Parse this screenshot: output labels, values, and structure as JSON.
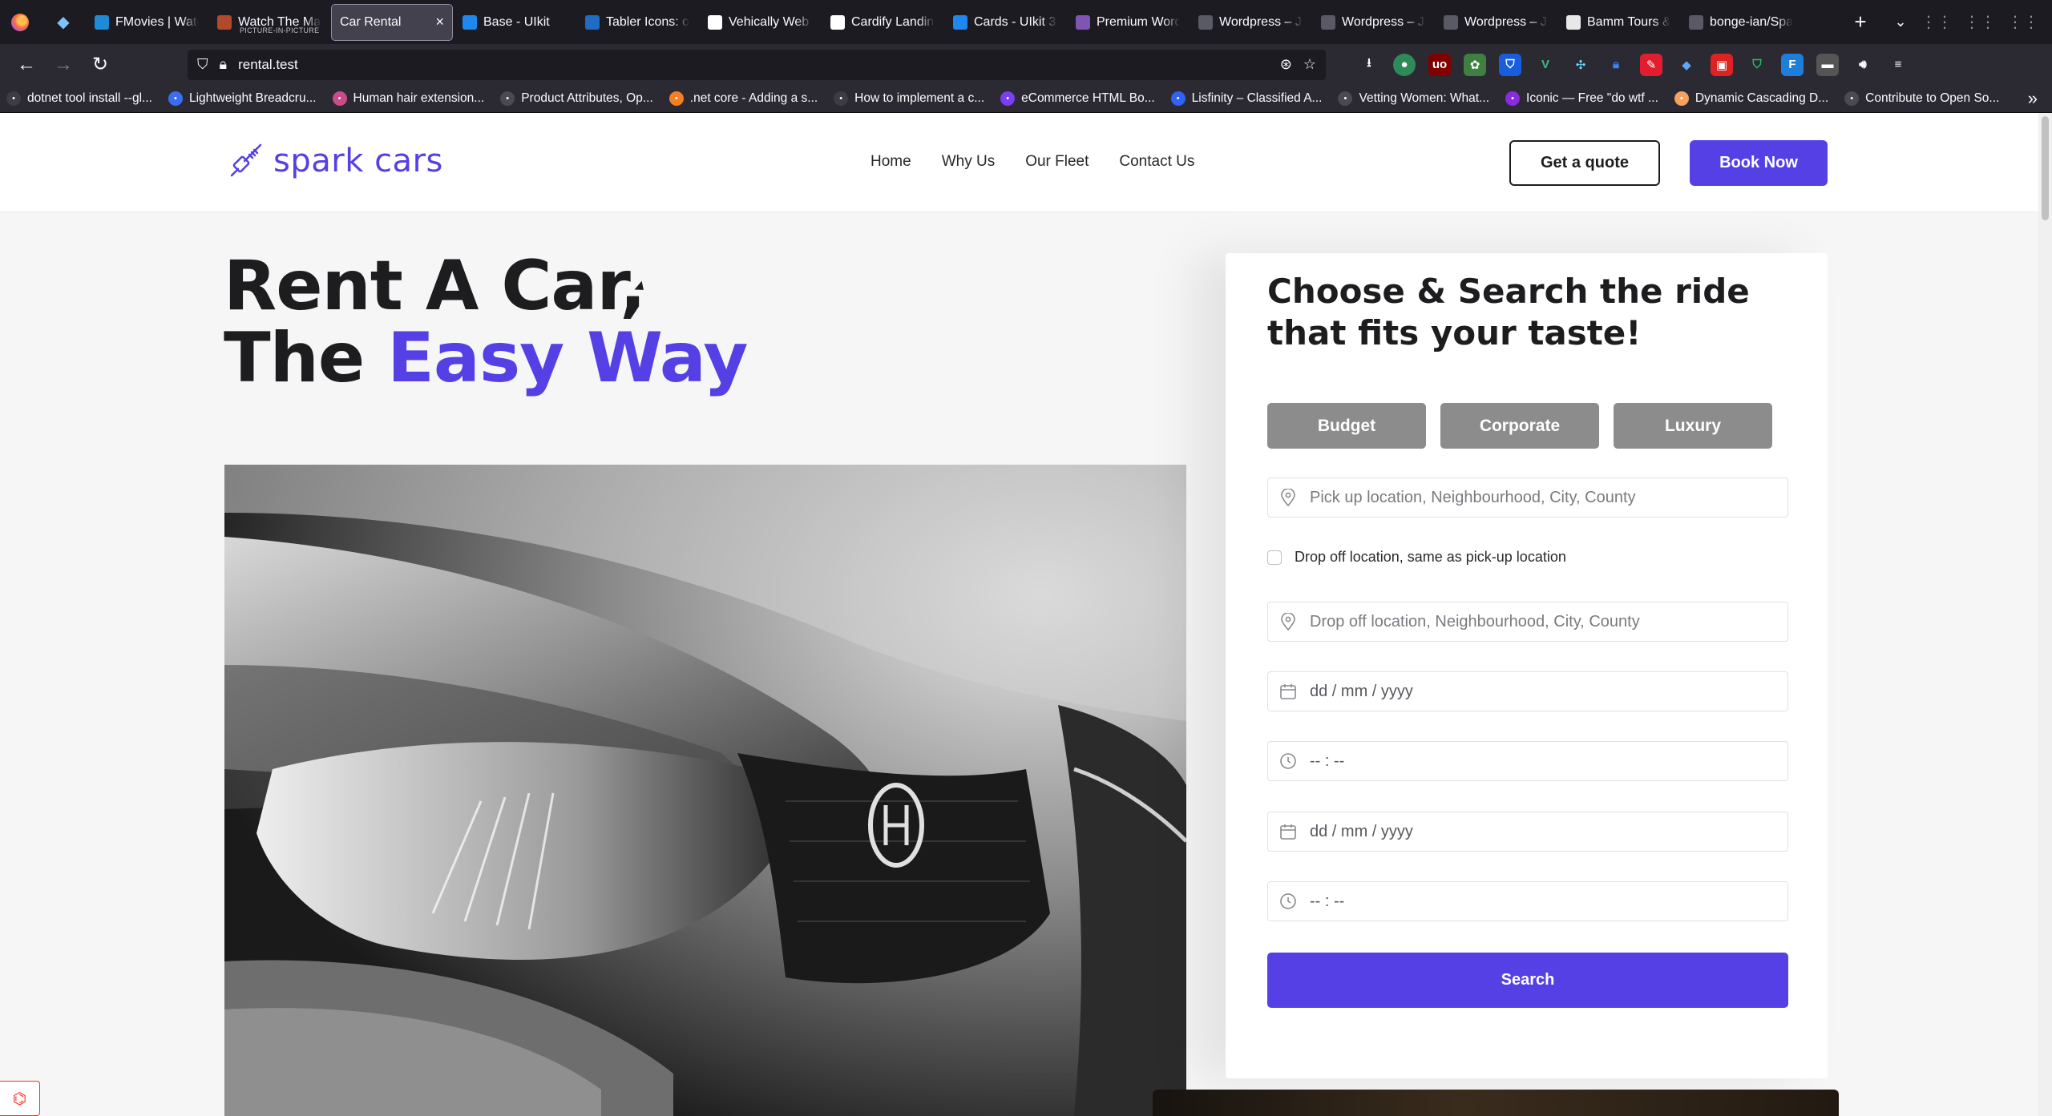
{
  "browser": {
    "pinned_tab_icon": "diamond-icon",
    "tabs": [
      {
        "title": "FMovies | Watch",
        "icon_color": "#1f8bd6",
        "icon": "play-icon"
      },
      {
        "title": "Watch The Ma",
        "subtitle": "PICTURE-IN-PICTURE",
        "icon_color": "#b04a2a",
        "icon": "film-icon"
      },
      {
        "title": "Car Rental",
        "active": true,
        "close": "×"
      },
      {
        "title": "Base - UIkit",
        "icon_color": "#1e87f0",
        "icon": "loading-icon"
      },
      {
        "title": "Tabler Icons: o",
        "icon_color": "#206bc4",
        "icon": "tabler-icon"
      },
      {
        "title": "Vehically Web",
        "icon_color": "#ffffff",
        "icon": "w-icon"
      },
      {
        "title": "Cardify Landin",
        "icon_color": "#ffffff",
        "icon": "w-icon"
      },
      {
        "title": "Cards - UIkit 3",
        "icon_color": "#1e87f0",
        "icon": "loading-icon"
      },
      {
        "title": "Premium Word",
        "icon_color": "#7f54b3",
        "icon": "woo-icon"
      },
      {
        "title": "Wordpress – Ju",
        "icon_color": "#5a5a64",
        "icon": "wordpress-icon"
      },
      {
        "title": "Wordpress – Ju",
        "icon_color": "#5a5a64",
        "icon": "wordpress-icon"
      },
      {
        "title": "Wordpress – Ju",
        "icon_color": "#5a5a64",
        "icon": "wordpress-icon"
      },
      {
        "title": "Bamm Tours &",
        "icon_color": "#e8e8e8",
        "icon": "tours-icon"
      },
      {
        "title": "bonge-ian/Spa",
        "icon_color": "#5a5a64",
        "icon": "github-icon"
      }
    ],
    "new_tab": "+",
    "tab_list": "⌄",
    "url": "rental.test",
    "bookmarks": [
      {
        "label": "dotnet tool install --gl...",
        "color": "#3c3c44"
      },
      {
        "label": "Lightweight Breadcru...",
        "color": "#3a6df0"
      },
      {
        "label": "Human hair extension...",
        "color": "#c94c8a"
      },
      {
        "label": "Product Attributes, Op...",
        "color": "#4a4a52"
      },
      {
        "label": ".net core - Adding a s...",
        "color": "#f48024"
      },
      {
        "label": "How to implement a c...",
        "color": "#3c3c44"
      },
      {
        "label": "eCommerce HTML Bo...",
        "color": "#7a3ff0"
      },
      {
        "label": "Lisfinity – Classified A...",
        "color": "#2f62f5"
      },
      {
        "label": "Vetting Women: What...",
        "color": "#4a4a52"
      },
      {
        "label": "Iconic — Free \"do wtf ...",
        "color": "#8a2be2"
      },
      {
        "label": "Dynamic Cascading D...",
        "color": "#f4a261"
      },
      {
        "label": "Contribute to Open So...",
        "color": "#4a4a52"
      }
    ]
  },
  "header": {
    "logo_text": "spark cars",
    "nav": [
      "Home",
      "Why Us",
      "Our Fleet",
      "Contact Us"
    ],
    "quote_label": "Get a quote",
    "book_label": "Book Now",
    "accent_color": "#5440e4"
  },
  "hero": {
    "line1": "Rent A Car,",
    "line2_plain": "The",
    "line2_accent": "Easy Way"
  },
  "search": {
    "title": "Choose & Search the ride that fits your taste!",
    "categories": [
      "Budget",
      "Corporate",
      "Luxury"
    ],
    "pickup_placeholder": "Pick up location, Neighbourhood, City, County",
    "same_location_label": "Drop off location, same as pick-up location",
    "dropoff_placeholder": "Drop off location, Neighbourhood, City, County",
    "pickup_date": "dd / mm / yyyy",
    "pickup_time": "-- : --",
    "dropoff_date": "dd / mm / yyyy",
    "dropoff_time": "-- : --",
    "submit_label": "Search"
  }
}
